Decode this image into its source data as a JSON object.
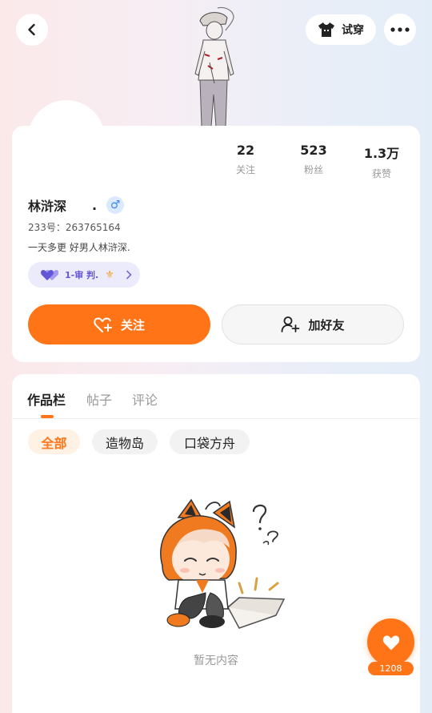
{
  "header": {
    "try_on_label": "试穿"
  },
  "profile": {
    "stats": [
      {
        "value": "22",
        "label": "关注"
      },
      {
        "value": "523",
        "label": "粉丝"
      },
      {
        "value": "1.3万",
        "label": "获赞"
      }
    ],
    "name": "林浒深",
    "name_suffix": ".",
    "gender_symbol": "♂",
    "uid": "233号：263765164",
    "bio": "一天多更 好男人林浒深.",
    "badge_text": "1-审 判.",
    "badge_fleur": "⚜"
  },
  "actions": {
    "follow_label": "关注",
    "add_friend_label": "加好友"
  },
  "tabs": [
    {
      "label": "作品栏",
      "active": true
    },
    {
      "label": "帖子",
      "active": false
    },
    {
      "label": "评论",
      "active": false
    }
  ],
  "filters": [
    {
      "label": "全部",
      "active": true
    },
    {
      "label": "造物岛",
      "active": false
    },
    {
      "label": "口袋方舟",
      "active": false
    }
  ],
  "empty_text": "暂无内容",
  "fab": {
    "count": "1208"
  },
  "colors": {
    "accent": "#ff7417",
    "badge_purple": "#6357d6",
    "gender_blue": "#3b86f5"
  }
}
